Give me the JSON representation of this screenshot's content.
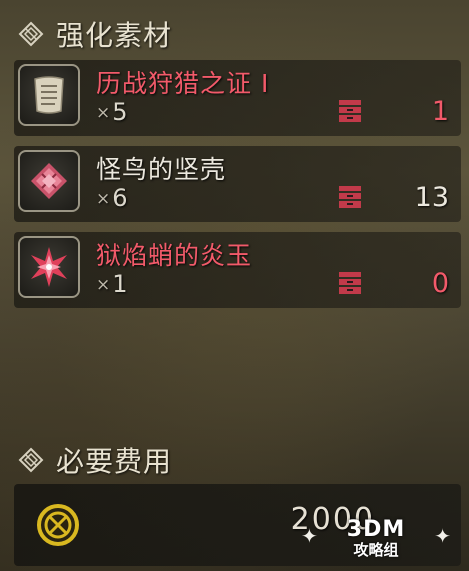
{
  "sections": {
    "materials": {
      "title": "强化素材",
      "icon": "diamond-emblem-icon"
    },
    "cost": {
      "title": "必要费用",
      "icon": "diamond-emblem-icon"
    }
  },
  "materials": [
    {
      "name": "历战狩猎之证 I",
      "name_color": "#f25a6a",
      "icon": "scroll-icon",
      "qty_prefix": "×",
      "qty": "5",
      "stock": "1",
      "stock_color": "#f25a6a",
      "stock_icon": "item-box-icon"
    },
    {
      "name": "怪鸟的坚壳",
      "name_color": "#ece8de",
      "icon": "shell-icon",
      "qty_prefix": "×",
      "qty": "6",
      "stock": "13",
      "stock_color": "#ece8de",
      "stock_icon": "item-box-icon"
    },
    {
      "name": "狱焰蛸的炎玉",
      "name_color": "#f25a6a",
      "icon": "gem-icon",
      "qty_prefix": "×",
      "qty": "1",
      "stock": "0",
      "stock_color": "#f25a6a",
      "stock_icon": "item-box-icon"
    }
  ],
  "cost": {
    "icon": "zenny-coin-icon",
    "value": "2000"
  },
  "watermark": {
    "logo": "3DM",
    "sub": "攻略组"
  }
}
